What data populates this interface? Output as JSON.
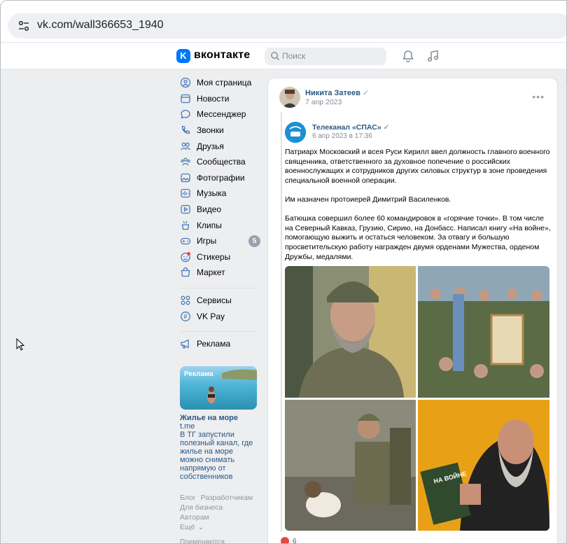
{
  "browser": {
    "url": "vk.com/wall366653_1940"
  },
  "header": {
    "logo_letter": "K",
    "brand": "вконтакте",
    "search_placeholder": "Поиск"
  },
  "sidebar": {
    "items": [
      {
        "label": "Моя страница",
        "icon": "user-circle-icon"
      },
      {
        "label": "Новости",
        "icon": "newspaper-icon"
      },
      {
        "label": "Мессенджер",
        "icon": "message-icon"
      },
      {
        "label": "Звонки",
        "icon": "phone-icon"
      },
      {
        "label": "Друзья",
        "icon": "friends-icon"
      },
      {
        "label": "Сообщества",
        "icon": "community-icon"
      },
      {
        "label": "Фотографии",
        "icon": "photo-icon"
      },
      {
        "label": "Музыка",
        "icon": "music-icon"
      },
      {
        "label": "Видео",
        "icon": "video-icon"
      },
      {
        "label": "Клипы",
        "icon": "clips-icon"
      },
      {
        "label": "Игры",
        "icon": "gamepad-icon",
        "badge": "5"
      },
      {
        "label": "Стикеры",
        "icon": "sticker-icon"
      },
      {
        "label": "Маркет",
        "icon": "market-bag-icon"
      }
    ],
    "services": [
      {
        "label": "Сервисы",
        "icon": "services-grid-icon"
      },
      {
        "label": "VK Pay",
        "icon": "vkpay-icon"
      }
    ],
    "ads_link": {
      "label": "Реклама",
      "icon": "megaphone-icon"
    }
  },
  "ad": {
    "tag": "Реклама",
    "title": "Жилье на море",
    "domain": "t.me",
    "text": "В ТГ запустили полезный канал, где жилье на море можно снимать напрямую от собственников"
  },
  "footer": {
    "links": [
      "Блог",
      "Разработчикам",
      "Для бизнеса",
      "Авторам",
      "Ещё"
    ],
    "bottom": "Применяются"
  },
  "post": {
    "author": "Никита Затеев",
    "date": "7 апр 2023",
    "repost": {
      "author": "Телеканал «СПАС»",
      "date": "6 апр 2023 в 17:36",
      "paragraphs": [
        "Патриарх Московский и всея Руси Кирилл ввел должность главного военного священника, ответственного за духовное попечение о российских военнослужащих и сотрудников других силовых структур в зоне проведения специальной военной операции.",
        "Им назначен протоиерей Димитрий Василенков.",
        "Батюшка совершил более 60 командировок в «горячие точки». В том числе на Северный Кавказ, Грузию, Сирию, на Донбасс. Написал книгу «На войне», помогающую выжить и остаться человеком. За отвагу и большую просветительскую работу награжден двумя орденами Мужества, орденом Дружбы, медалями."
      ],
      "book_title": "НА ВОЙНЕ"
    },
    "likes": "6"
  },
  "colors": {
    "accent": "#0077ff",
    "link": "#2a5885",
    "nav_icon": "#447bba",
    "background": "#edeef0",
    "like": "#e64646"
  }
}
